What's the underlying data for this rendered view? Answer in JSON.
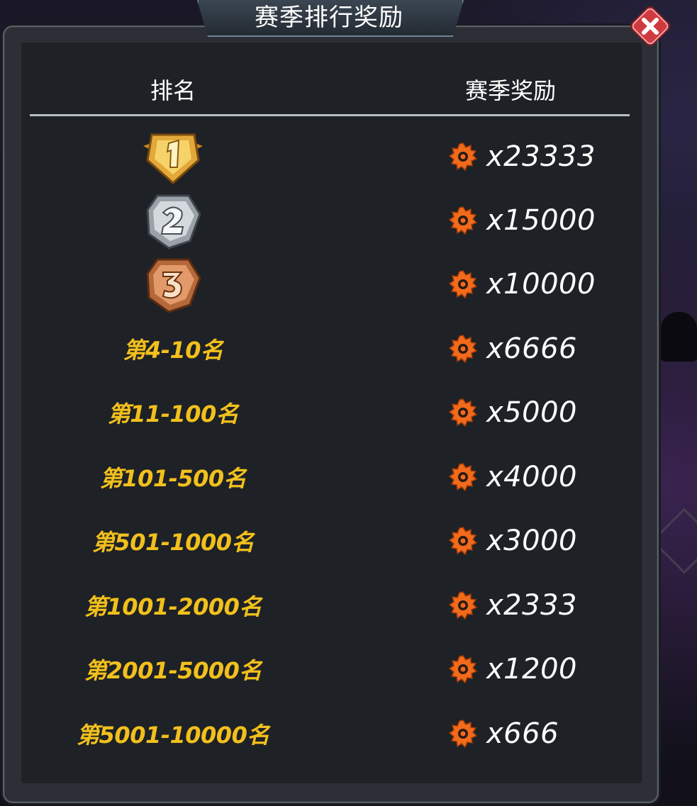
{
  "title": "赛季排行奖励",
  "headers": {
    "rank": "排名",
    "reward": "赛季奖励"
  },
  "rows": [
    {
      "rank_icon": "gold-medal-1-icon",
      "reward": "x23333"
    },
    {
      "rank_icon": "silver-medal-2-icon",
      "reward": "x15000"
    },
    {
      "rank_icon": "bronze-medal-3-icon",
      "reward": "x10000"
    },
    {
      "rank": "第4-10名",
      "reward": "x6666"
    },
    {
      "rank": "第11-100名",
      "reward": "x5000"
    },
    {
      "rank": "第101-500名",
      "reward": "x4000"
    },
    {
      "rank": "第501-1000名",
      "reward": "x3000"
    },
    {
      "rank": "第1001-2000名",
      "reward": "x2333"
    },
    {
      "rank": "第2001-5000名",
      "reward": "x1200"
    },
    {
      "rank": "第5001-10000名",
      "reward": "x666"
    }
  ],
  "reward_icon": "orange-gear-icon",
  "colors": {
    "rank_text": "#f2c01c",
    "reward_icon": "#f26a1b",
    "close_button": "#c9373c",
    "panel": "#1e2126"
  }
}
